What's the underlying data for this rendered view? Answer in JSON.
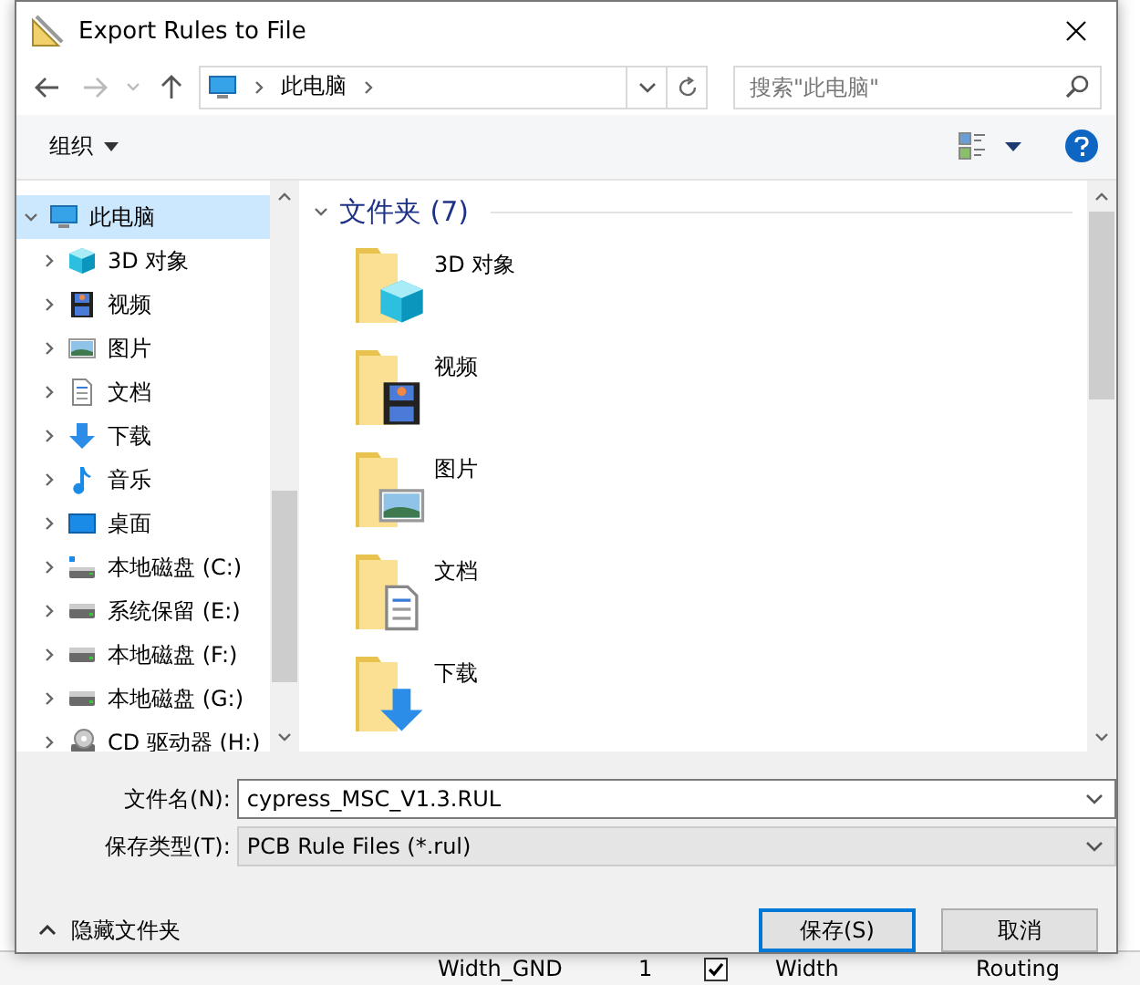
{
  "window": {
    "title": "Export Rules to File"
  },
  "address": {
    "path": "此电脑"
  },
  "search": {
    "placeholder": "搜索\"此电脑\""
  },
  "toolbar": {
    "organize": "组织"
  },
  "nav_tree": [
    {
      "label": "此电脑",
      "kind": "pc",
      "expanded": true,
      "selected": true,
      "children": [
        {
          "label": "3D 对象",
          "kind": "cube",
          "expanded": false,
          "selected": false
        },
        {
          "label": "视频",
          "kind": "film",
          "expanded": false,
          "selected": false
        },
        {
          "label": "图片",
          "kind": "picture",
          "expanded": false,
          "selected": false
        },
        {
          "label": "文档",
          "kind": "doc",
          "expanded": false,
          "selected": false
        },
        {
          "label": "下载",
          "kind": "download",
          "expanded": false,
          "selected": false
        },
        {
          "label": "音乐",
          "kind": "music",
          "expanded": false,
          "selected": false
        },
        {
          "label": "桌面",
          "kind": "desktop",
          "expanded": false,
          "selected": false
        },
        {
          "label": "本地磁盘 (C:)",
          "kind": "windrive",
          "expanded": false,
          "selected": false
        },
        {
          "label": "系统保留 (E:)",
          "kind": "drive",
          "expanded": false,
          "selected": false
        },
        {
          "label": "本地磁盘 (F:)",
          "kind": "drive",
          "expanded": false,
          "selected": false
        },
        {
          "label": "本地磁盘 (G:)",
          "kind": "drive",
          "expanded": false,
          "selected": false
        },
        {
          "label": "CD 驱动器 (H:)",
          "kind": "cd",
          "expanded": false,
          "selected": false
        }
      ]
    }
  ],
  "section": {
    "title": "文件夹 (7)",
    "expanded": true
  },
  "folders": [
    {
      "name": "3D 对象",
      "kind": "cube"
    },
    {
      "name": "视频",
      "kind": "film"
    },
    {
      "name": "图片",
      "kind": "picture"
    },
    {
      "name": "文档",
      "kind": "doc"
    },
    {
      "name": "下载",
      "kind": "download"
    }
  ],
  "form": {
    "filename_label": "文件名(N):",
    "filename": "cypress_MSC_V1.3.RUL",
    "type_label": "保存类型(T):",
    "type": "PCB Rule Files (*.rul)"
  },
  "hide_folders": "隐藏文件夹",
  "buttons": [
    {
      "label": "保存(S)",
      "default": true
    },
    {
      "label": "取消",
      "default": false
    }
  ],
  "background_row": {
    "name": "Width_GND",
    "priority": "1",
    "enabled": true,
    "type": "Width",
    "category": "Routing"
  }
}
